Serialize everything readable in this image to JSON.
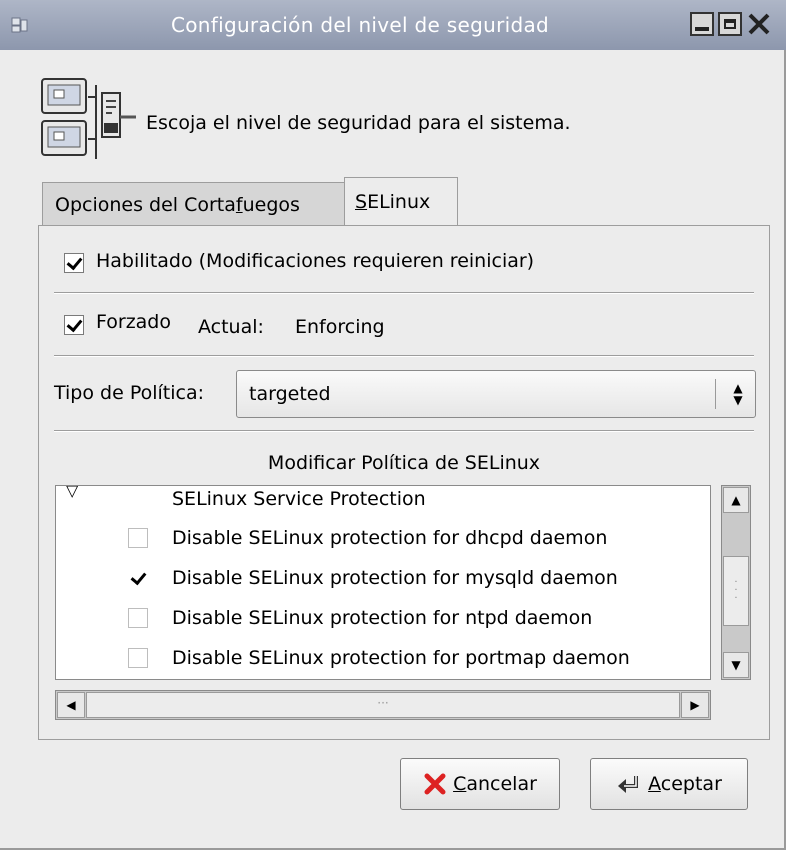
{
  "window": {
    "title": "Configuración del nivel de seguridad"
  },
  "header": {
    "text": "Escoja el nivel de seguridad para el sistema."
  },
  "tabs": [
    {
      "label_pre": "Opciones del Corta",
      "label_u": "f",
      "label_post": "uegos",
      "selected": false
    },
    {
      "label_pre": "",
      "label_u": "S",
      "label_post": "ELinux",
      "selected": true
    }
  ],
  "selinux": {
    "enabled_label": "Habilitado (Modificaciones requieren reiniciar)",
    "enabled_checked": true,
    "enforcing_label": "Forzado",
    "enforcing_checked": true,
    "current_label": "Actual:",
    "current_value": "Enforcing",
    "policy_label": "Tipo de Política:",
    "policy_value": "targeted",
    "modify_title": "Modificar Política de SELinux",
    "tree": {
      "group": "SELinux Service Protection",
      "items": [
        {
          "label": "Disable SELinux protection for dhcpd daemon",
          "checked": false
        },
        {
          "label": "Disable SELinux protection for mysqld daemon",
          "checked": true
        },
        {
          "label": "Disable SELinux protection for ntpd daemon",
          "checked": false
        },
        {
          "label": "Disable SELinux protection for portmap daemon",
          "checked": false
        }
      ]
    }
  },
  "buttons": {
    "cancel_u": "C",
    "cancel_rest": "ancelar",
    "ok_u": "A",
    "ok_rest": "ceptar"
  },
  "icons": {
    "app": "security-level-icon",
    "header": "network-computers-icon",
    "cancel": "red-x-icon",
    "ok": "return-arrow-icon"
  }
}
